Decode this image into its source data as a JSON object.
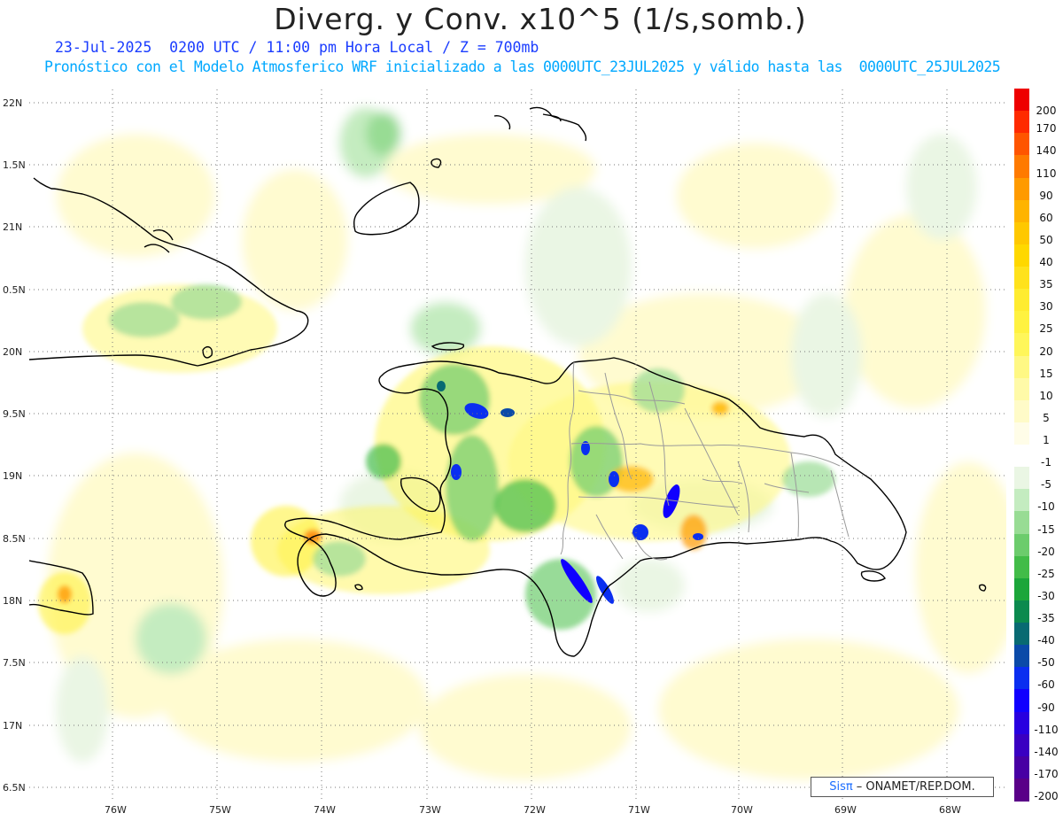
{
  "title": "Diverg. y Conv. x10^5 (1/s,somb.)",
  "subtitle_time": "23-Jul-2025  0200 UTC / 11:00 pm Hora Local / Z = 700mb",
  "subtitle_model": "Pronóstico con el Modelo Atmosferico WRF inicializado a las 0000UTC_23JUL2025 y válido hasta las  0000UTC_25JUL2025",
  "lat_labels": [
    "22N",
    "1.5N",
    "21N",
    "0.5N",
    "20N",
    "9.5N",
    "19N",
    "8.5N",
    "18N",
    "7.5N",
    "17N",
    "6.5N"
  ],
  "lon_labels": [
    "76W",
    "75W",
    "74W",
    "73W",
    "72W",
    "71W",
    "70W",
    "69W",
    "68W"
  ],
  "colorbar": {
    "labels": [
      "200",
      "170",
      "140",
      "110",
      "90",
      "60",
      "50",
      "40",
      "35",
      "30",
      "25",
      "20",
      "15",
      "10",
      "5",
      "1",
      "-1",
      "-5",
      "-10",
      "-15",
      "-20",
      "-25",
      "-30",
      "-35",
      "-40",
      "-50",
      "-60",
      "-90",
      "-110",
      "-140",
      "-170",
      "-200"
    ],
    "colors": [
      "#ee0000",
      "#ff2a00",
      "#ff5500",
      "#ff7a00",
      "#ff9a00",
      "#ffb400",
      "#ffc800",
      "#ffd800",
      "#ffe21c",
      "#ffec30",
      "#fff240",
      "#fff65a",
      "#fff884",
      "#fffaa8",
      "#fffbc8",
      "#fffde8",
      "#ffffff",
      "#eaf6e4",
      "#c4ecc0",
      "#98dc94",
      "#6ccc6c",
      "#42bc48",
      "#1ca63a",
      "#0b8a4e",
      "#086a72",
      "#0a4aa8",
      "#0a2ef0",
      "#1000ff",
      "#2800e0",
      "#3a00c2",
      "#4800a4",
      "#5a0088"
    ]
  },
  "credit": {
    "brand": "Sisπ",
    "org": "– ONAMET/REP.DOM."
  }
}
